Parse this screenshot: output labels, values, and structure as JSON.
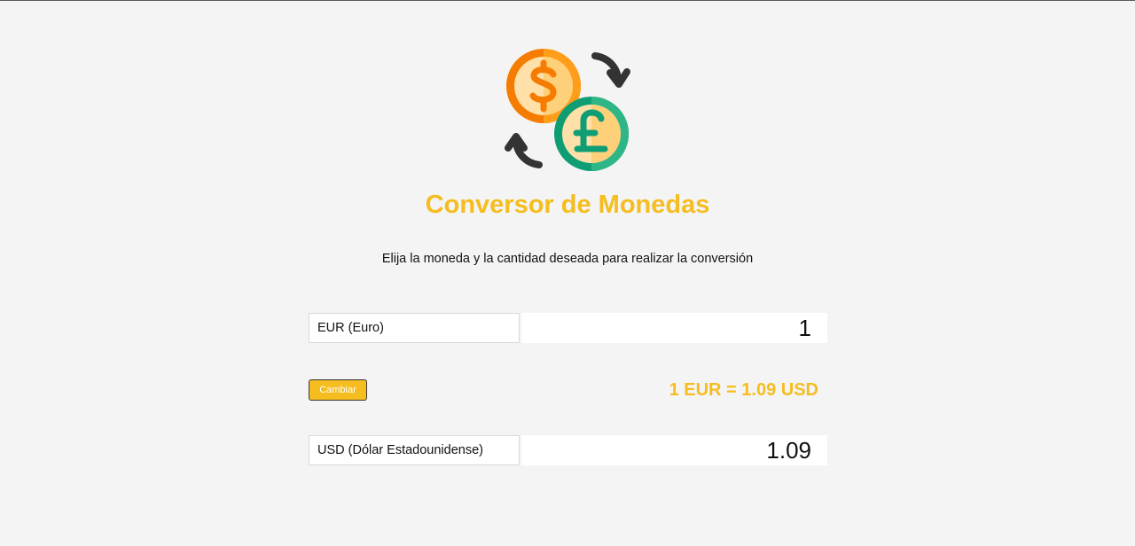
{
  "header": {
    "title": "Conversor de Monedas",
    "subtitle": "Elija la moneda y la cantidad deseada para realizar la conversión",
    "logo_icon": "currency-exchange-icon"
  },
  "converter": {
    "from": {
      "currency": "EUR (Euro)",
      "amount": "1"
    },
    "to": {
      "currency": "USD (Dólar Estadounidense)",
      "amount": "1.09"
    },
    "swap_label": "Cambiar",
    "rate_text": "1 EUR = 1.09 USD"
  },
  "colors": {
    "accent": "#f5bd1f",
    "background": "#f4f4f4",
    "dollar_coin": "#f57c00",
    "pound_coin": "#0f9d74",
    "arrows": "#333333"
  }
}
